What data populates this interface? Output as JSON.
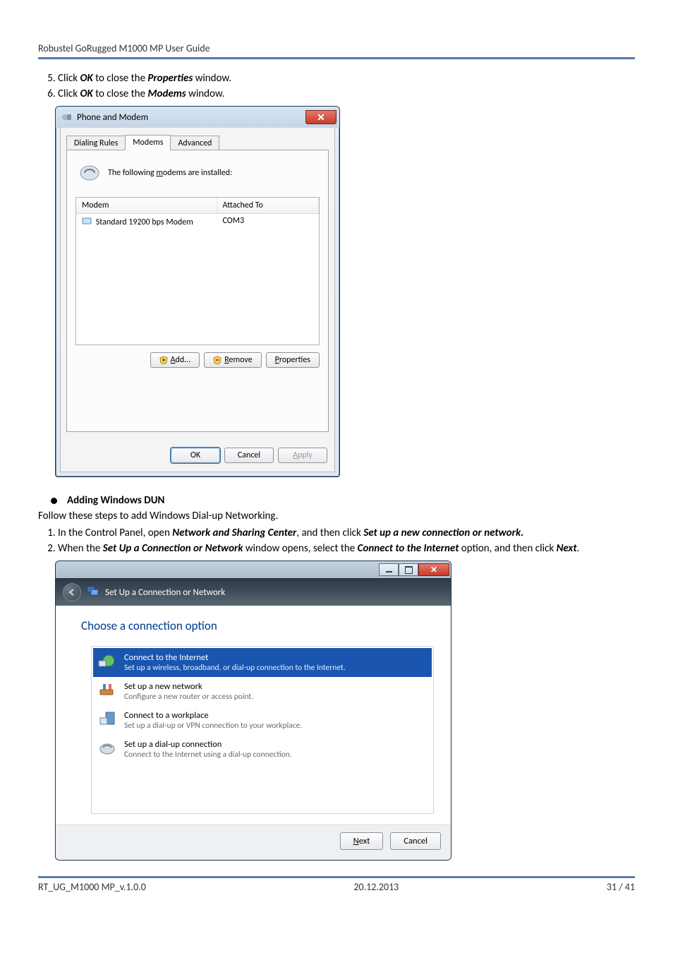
{
  "doc": {
    "header": "Robustel GoRugged M1000 MP User Guide",
    "footer_left": "RT_UG_M1000 MP_v.1.0.0",
    "footer_center": "20.12.2013",
    "footer_right": "31 / 41"
  },
  "steps_top": {
    "start": "5",
    "li5_a": "Click ",
    "li5_b": "OK",
    "li5_c": " to close the ",
    "li5_d": "Properties",
    "li5_e": " window.",
    "li6_a": "Click ",
    "li6_b": "OK",
    "li6_c": " to close the ",
    "li6_d": "Modems",
    "li6_e": " window."
  },
  "dlg1": {
    "title": "Phone and Modem",
    "tabs": {
      "t1": "Dialing Rules",
      "t2": "Modems",
      "t3": "Advanced"
    },
    "panel_text_a": "The following ",
    "panel_text_u": "m",
    "panel_text_b": "odems are installed:",
    "col_modem": "Modem",
    "col_attached": "Attached To",
    "row_modem": "Standard 19200 bps Modem",
    "row_port": "COM3",
    "btn_add_u": "A",
    "btn_add": "dd...",
    "btn_remove_u": "R",
    "btn_remove": "emove",
    "btn_properties_u": "P",
    "btn_properties": "roperties",
    "btn_ok": "OK",
    "btn_cancel": "Cancel",
    "btn_apply_u": "A",
    "btn_apply": "pply"
  },
  "section": {
    "heading": "Adding Windows DUN",
    "follow": "Follow these steps to add Windows Dial-up Networking.",
    "li1_a": "In the Control Panel, open ",
    "li1_b": "Network and Sharing Center",
    "li1_c": ", and then click ",
    "li1_d": "Set up a new connection or network",
    "li1_e": ".",
    "li2_a": "When the ",
    "li2_b": "Set Up a Connection or Network",
    "li2_c": " window opens, select the ",
    "li2_d": "Connect to the Internet",
    "li2_e": " option, and then click ",
    "li2_f": "Next",
    "li2_g": "."
  },
  "wizard": {
    "breadcrumb": "Set Up a Connection or Network",
    "title": "Choose a connection option",
    "options": [
      {
        "title": "Connect to the Internet",
        "desc": "Set up a wireless, broadband, or dial-up connection to the Internet."
      },
      {
        "title": "Set up a new network",
        "desc": "Configure a new router or access point."
      },
      {
        "title": "Connect to a workplace",
        "desc": "Set up a dial-up or VPN connection to your workplace."
      },
      {
        "title": "Set up a dial-up connection",
        "desc": "Connect to the Internet using a dial-up connection."
      }
    ],
    "btn_next_u": "N",
    "btn_next": "ext",
    "btn_cancel": "Cancel"
  }
}
